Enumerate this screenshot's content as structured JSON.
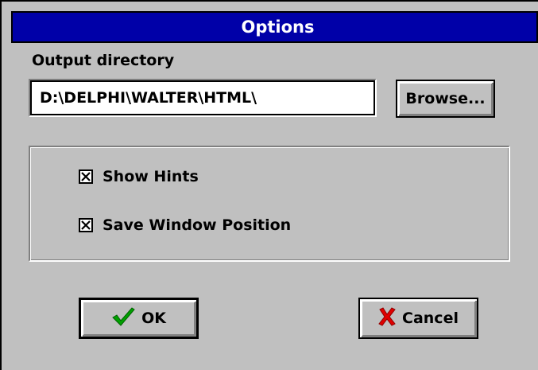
{
  "window": {
    "title": "Options"
  },
  "output": {
    "label": "Output directory",
    "path_value": "D:\\DELPHI\\WALTER\\HTML\\",
    "browse_label": "Browse..."
  },
  "options": {
    "items": [
      {
        "label": "Show Hints",
        "checked": true
      },
      {
        "label": "Save Window Position",
        "checked": true
      }
    ]
  },
  "buttons": {
    "ok_label": "OK",
    "ok_icon": "checkmark-icon",
    "cancel_label": "Cancel",
    "cancel_icon": "x-mark-icon"
  },
  "colors": {
    "title_bar": "#0000a8",
    "face": "#c0c0c0",
    "checkmark": "#00a000",
    "cancel_x": "#e00000"
  }
}
